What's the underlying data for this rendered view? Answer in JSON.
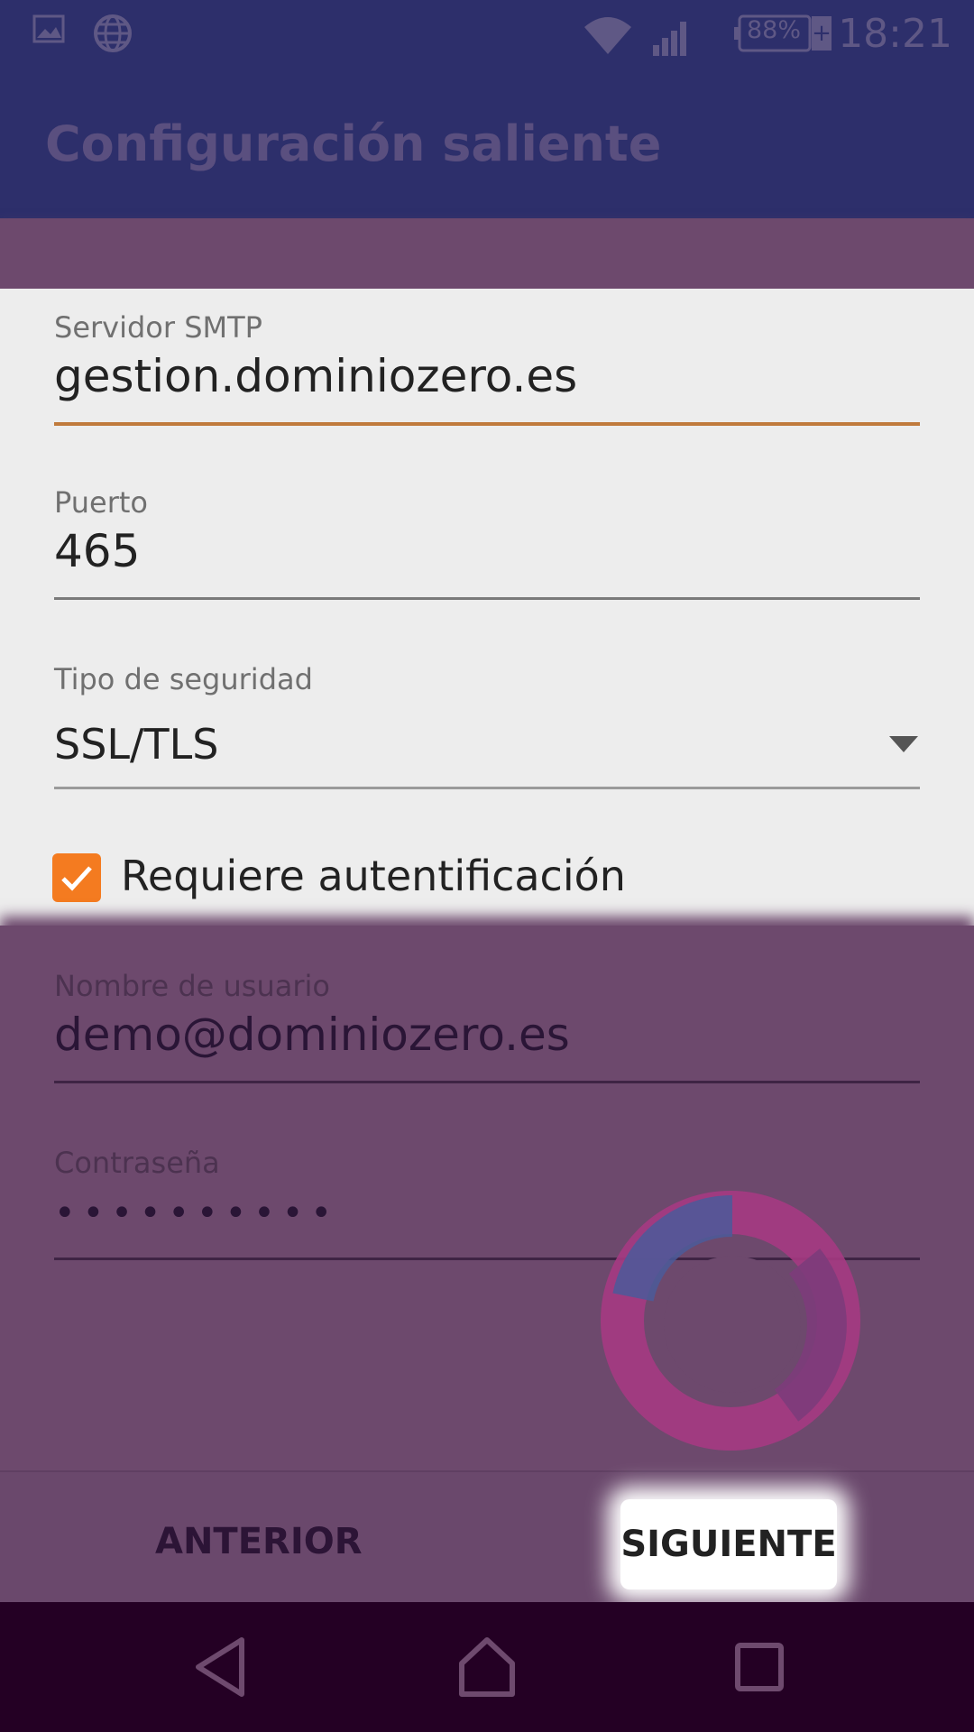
{
  "status_bar": {
    "battery": "88%",
    "time": "18:21",
    "icons": [
      "image-icon",
      "globe-icon",
      "wifi-icon",
      "signal-icon",
      "battery-icon"
    ]
  },
  "app_bar": {
    "title": "Configuración saliente"
  },
  "form": {
    "smtp": {
      "label": "Servidor SMTP",
      "value": "gestion.dominiozero.es"
    },
    "port": {
      "label": "Puerto",
      "value": "465"
    },
    "security": {
      "label": "Tipo de seguridad",
      "value": "SSL/TLS"
    },
    "auth": {
      "label": "Requiere autentificación",
      "checked": true
    },
    "username": {
      "label": "Nombre de usuario",
      "value": "demo@dominiozero.es"
    },
    "password": {
      "label": "Contraseña",
      "value": "••••••••••"
    }
  },
  "buttons": {
    "prev": "ANTERIOR",
    "next": "SIGUIENTE"
  },
  "colors": {
    "app_bar": "#2d2f6b",
    "overlay": "#6d496d",
    "accent": "#f47b20",
    "nav_bar": "#240024"
  }
}
